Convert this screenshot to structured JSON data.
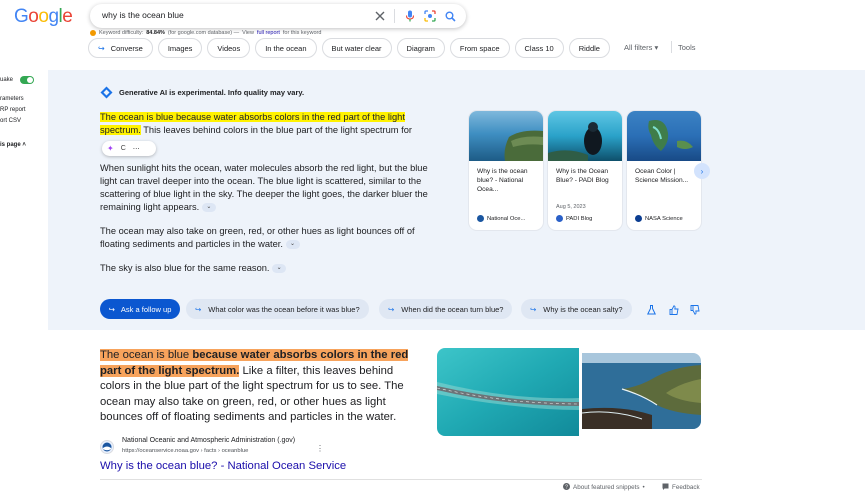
{
  "logo": "Google",
  "search": {
    "query": "why is the ocean blue"
  },
  "keyword_line": {
    "prefix": "Keyword difficulty:",
    "value": "84.84%",
    "source": "(for google.com database) —",
    "link_prefix": "View",
    "link": "full report",
    "suffix": "for this keyword"
  },
  "chips": [
    "Converse",
    "Images",
    "Videos",
    "In the ocean",
    "But water clear",
    "Diagram",
    "From space",
    "Class 10",
    "Riddle"
  ],
  "filters": {
    "all_filters": "All filters",
    "tools": "Tools"
  },
  "left_panel": {
    "line1": "uake",
    "line2": "rameters",
    "line3": "RP report",
    "line4": "ort CSV",
    "line5": "is page"
  },
  "ai": {
    "header": "Generative AI is experimental. Info quality may vary.",
    "p1_highlight": "The ocean is blue because water absorbs colors in the red part of the light spectrum.",
    "p1_rest": " This leaves behind colors in the blue part of the light spectrum for",
    "p2": "When sunlight hits the ocean, water molecules absorb the red light, but the blue light can travel deeper into the ocean. The blue light is scattered, similar to the scattering of blue light in the sky. The deeper the light goes, the darker bluer the remaining light appears.",
    "p3": "The ocean may also take on green, red, or other hues as light bounces off of floating sediments and particles in the water.",
    "p4": "The sky is also blue for the same reason.",
    "minitool_label": "C"
  },
  "cards": [
    {
      "title": "Why is the ocean blue? - National Ocea...",
      "date": "",
      "source": "National Oce...",
      "fav_color": "#1a56a0",
      "img_top": "#3f8fc2",
      "img_bottom": "#1d5b86"
    },
    {
      "title": "Why is the Ocean Blue? - PADI Blog",
      "date": "Aug 5, 2023",
      "source": "PADI Blog",
      "fav_color": "#2a60c8",
      "img_top": "#2aa2c9",
      "img_bottom": "#0e4f6b"
    },
    {
      "title": "Ocean Color | Science Mission...",
      "date": "",
      "source": "NASA Science",
      "fav_color": "#0b3d91",
      "img_top": "#2b6fb6",
      "img_bottom": "#184a86"
    }
  ],
  "followups": {
    "ask": "Ask a follow up",
    "q1": "What color was the ocean before it was blue?",
    "q2": "When did the ocean turn blue?",
    "q3": "Why is the ocean salty?"
  },
  "snippet": {
    "h1": "The ocean is blue ",
    "h2": "because water absorbs colors in the red part of the light spectrum.",
    "rest": " Like a filter, this leaves behind colors in the blue part of the light spectrum for us to see. The ocean may also take on green, red, or other hues as light bounces off of floating sediments and particles in the water.",
    "source_name": "National Oceanic and Atmospheric Administration (.gov)",
    "source_url": "https://oceanservice.noaa.gov › facts › oceanblue",
    "link": "Why is the ocean blue? - National Ocean Service"
  },
  "footer": {
    "about": "About featured snippets",
    "sep": "•",
    "feedback": "Feedback"
  },
  "colors": {
    "accent": "#1a73e8",
    "ai_bg": "#eef3fa",
    "highlight_yellow": "#fff200",
    "highlight_orange": "#f7a35c",
    "link": "#1a0dab"
  }
}
